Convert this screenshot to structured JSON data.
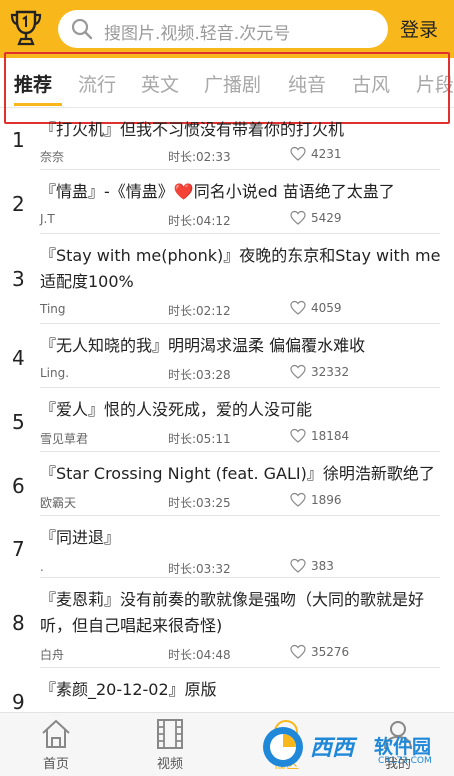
{
  "header": {
    "search_placeholder": "搜图片.视频.轻音.次元号",
    "login_label": "登录"
  },
  "tabs": [
    {
      "label": "推荐",
      "active": true
    },
    {
      "label": "流行",
      "active": false
    },
    {
      "label": "英文",
      "active": false
    },
    {
      "label": "广播剧",
      "active": false
    },
    {
      "label": "纯音",
      "active": false
    },
    {
      "label": "古风",
      "active": false
    },
    {
      "label": "片段",
      "active": false
    }
  ],
  "songs": [
    {
      "rank": "1",
      "title": "『打火机』但我不习惯没有带着你的打火机",
      "artist": "奈奈",
      "duration": "时长:02:33",
      "likes": "4231"
    },
    {
      "rank": "2",
      "title": "『情蛊』-《情蛊》❤️同名小说ed 苗语绝了太蛊了",
      "artist": "J.T",
      "duration": "时长:04:12",
      "likes": "5429"
    },
    {
      "rank": "3",
      "title": "『Stay with me(phonk)』夜晚的东京和Stay with me适配度100%",
      "artist": "Ting",
      "duration": "时长:02:12",
      "likes": "4059"
    },
    {
      "rank": "4",
      "title": "『无人知晓的我』明明渴求温柔 偏偏覆水难收",
      "artist": "Ling.",
      "duration": "时长:03:28",
      "likes": "32332"
    },
    {
      "rank": "5",
      "title": "『爱人』恨的人没死成，爱的人没可能",
      "artist": "雪见草君",
      "duration": "时长:05:11",
      "likes": "18184"
    },
    {
      "rank": "6",
      "title": "『Star Crossing Night (feat. GALI)』徐明浩新歌绝了",
      "artist": "欧霸天",
      "duration": "时长:03:25",
      "likes": "1896"
    },
    {
      "rank": "7",
      "title": "『同进退』",
      "artist": ".",
      "duration": "时长:03:32",
      "likes": "383"
    },
    {
      "rank": "8",
      "title": "『麦恩莉』没有前奏的歌就像是强吻（大同的歌就是好听，但自己唱起来很奇怪)",
      "artist": "白舟",
      "duration": "时长:04:48",
      "likes": "35276"
    },
    {
      "rank": "9",
      "title": "『素颜_20-12-02』原版",
      "artist": "",
      "duration": "",
      "likes": ""
    }
  ],
  "bottom_nav": [
    {
      "label": "首页",
      "icon": "home-icon"
    },
    {
      "label": "视频",
      "icon": "film-icon"
    },
    {
      "label": "社区",
      "icon": "community-icon"
    },
    {
      "label": "我的",
      "icon": "profile-icon"
    }
  ],
  "watermark": {
    "text_a": "西西",
    "text_b": "软件园",
    "sub": "CR173.COM"
  },
  "colors": {
    "accent": "#f8b81b",
    "highlight_box": "#e0312f",
    "watermark": "#1f88d8"
  }
}
